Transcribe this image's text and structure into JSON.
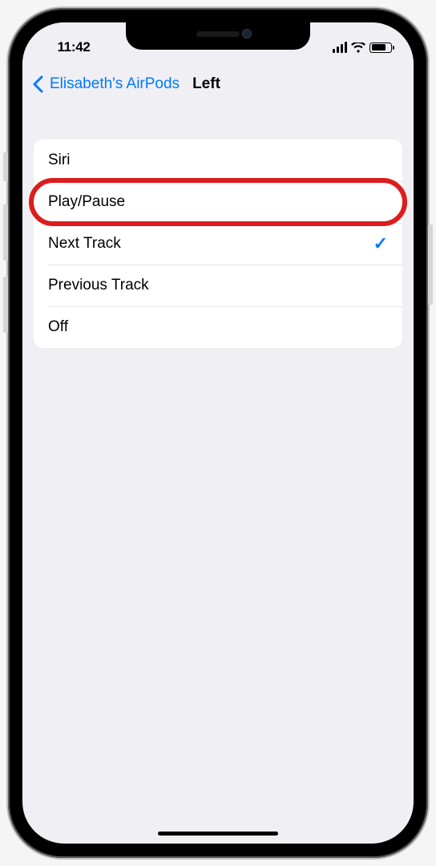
{
  "status_bar": {
    "time": "11:42"
  },
  "nav": {
    "back_label": "Elisabeth's AirPods",
    "title": "Left"
  },
  "options": [
    {
      "label": "Siri",
      "selected": false,
      "highlighted": false
    },
    {
      "label": "Play/Pause",
      "selected": false,
      "highlighted": true
    },
    {
      "label": "Next Track",
      "selected": true,
      "highlighted": false
    },
    {
      "label": "Previous Track",
      "selected": false,
      "highlighted": false
    },
    {
      "label": "Off",
      "selected": false,
      "highlighted": false
    }
  ],
  "colors": {
    "accent": "#007aff",
    "highlight_ring": "#dc1d1d",
    "background": "#efeff4"
  }
}
